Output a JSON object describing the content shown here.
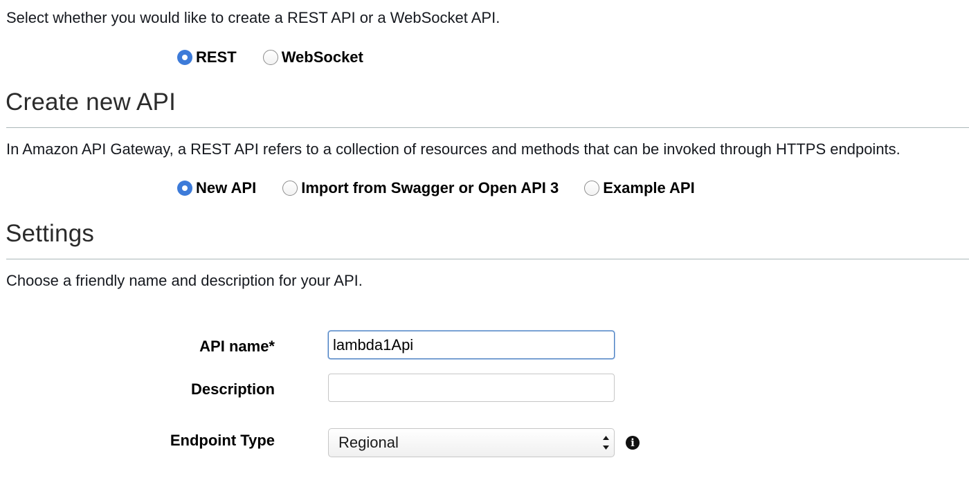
{
  "api_type": {
    "prompt": "Select whether you would like to create a REST API or a WebSocket API.",
    "options": [
      {
        "label": "REST",
        "checked": true
      },
      {
        "label": "WebSocket",
        "checked": false
      }
    ]
  },
  "create_section": {
    "heading": "Create new API",
    "description": "In Amazon API Gateway, a REST API refers to a collection of resources and methods that can be invoked through HTTPS endpoints.",
    "options": [
      {
        "label": "New API",
        "checked": true
      },
      {
        "label": "Import from Swagger or Open API 3",
        "checked": false
      },
      {
        "label": "Example API",
        "checked": false
      }
    ]
  },
  "settings_section": {
    "heading": "Settings",
    "description": "Choose a friendly name and description for your API.",
    "api_name": {
      "label": "API name*",
      "value": "lambda1Api",
      "placeholder": ""
    },
    "description_field": {
      "label": "Description",
      "value": "",
      "placeholder": ""
    },
    "endpoint_type": {
      "label": "Endpoint Type",
      "selected": "Regional",
      "info_icon": "info-icon"
    }
  },
  "colors": {
    "radio_selected": "#3d7bd9",
    "input_focus_border": "#4a7fc0",
    "divider": "#aab7b8"
  }
}
